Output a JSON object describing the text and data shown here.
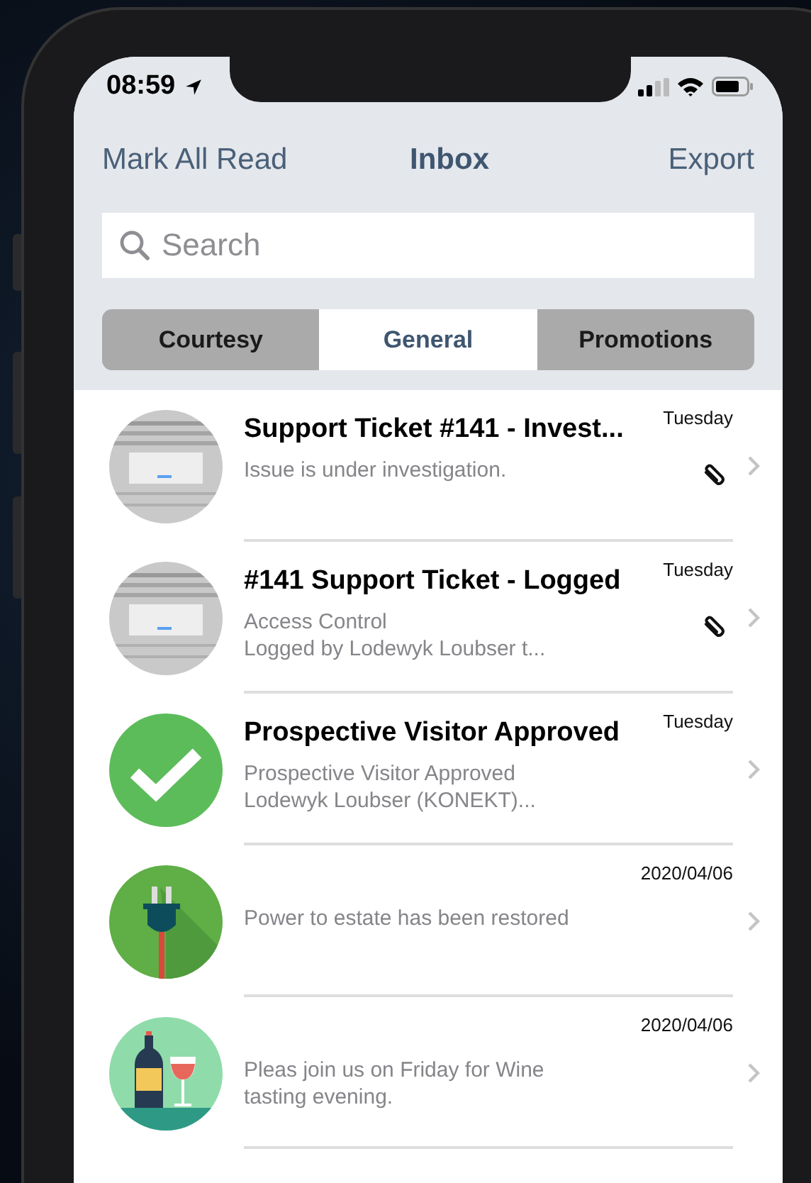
{
  "status_bar": {
    "time": "08:59"
  },
  "nav": {
    "left": "Mark All Read",
    "title": "Inbox",
    "right": "Export"
  },
  "search": {
    "placeholder": "Search"
  },
  "tabs": [
    {
      "label": "Courtesy",
      "selected": false
    },
    {
      "label": "General",
      "selected": true
    },
    {
      "label": "Promotions",
      "selected": false
    }
  ],
  "messages": [
    {
      "kind": "picture",
      "title": "Support Ticket #141 - Invest...",
      "date": "Tuesday",
      "lines": [
        "Issue is under investigation."
      ],
      "attachment": true
    },
    {
      "kind": "picture",
      "title": "#141 Support Ticket - Logged",
      "date": "Tuesday",
      "lines": [
        "Access Control",
        "Logged by Lodewyk Loubser t..."
      ],
      "attachment": true
    },
    {
      "kind": "check",
      "title": "Prospective Visitor Approved",
      "date": "Tuesday",
      "lines": [
        "Prospective Visitor Approved",
        "Lodewyk Loubser (KONEKT)..."
      ],
      "attachment": false
    },
    {
      "kind": "plug",
      "date": "2020/04/06",
      "lines": [
        "Power to estate has been restored"
      ],
      "attachment": false
    },
    {
      "kind": "wine",
      "date": "2020/04/06",
      "lines": [
        "Pleas join us on Friday for Wine",
        "tasting evening."
      ],
      "attachment": false
    }
  ]
}
